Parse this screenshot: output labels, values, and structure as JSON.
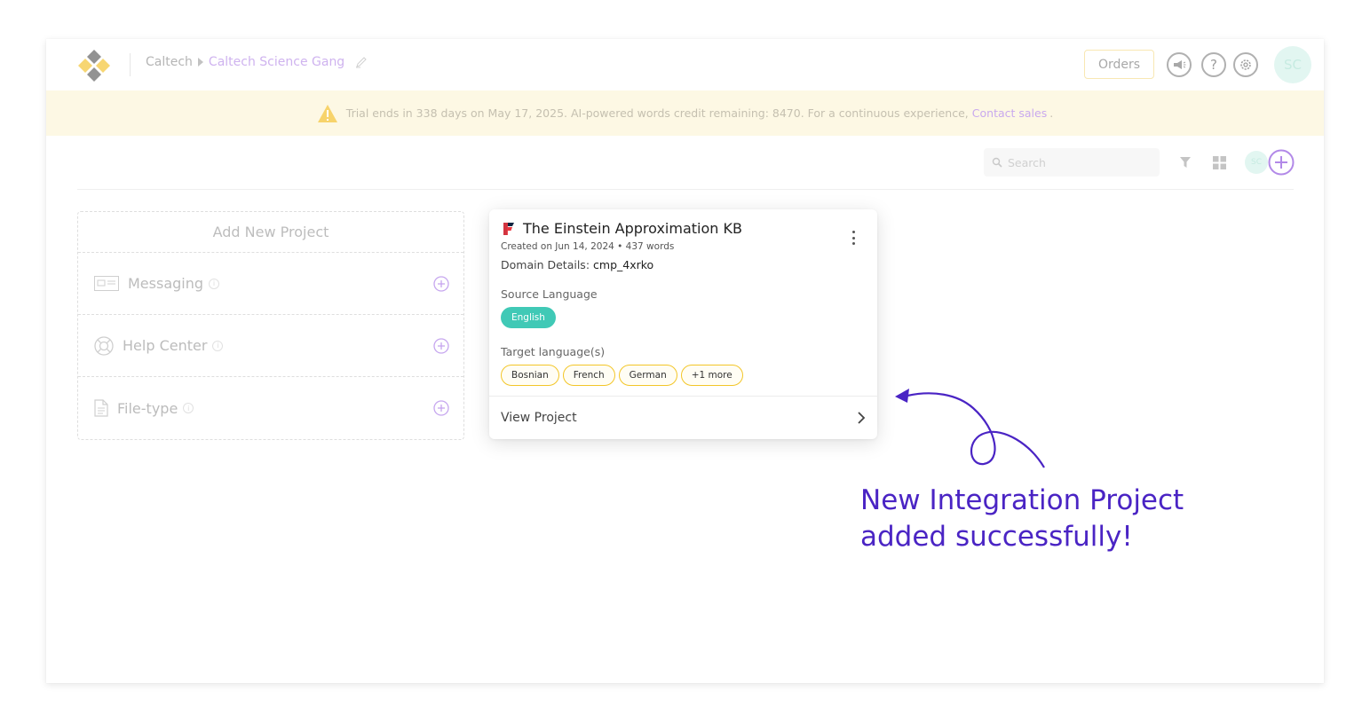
{
  "header": {
    "breadcrumb_org": "Caltech",
    "breadcrumb_workspace": "Caltech Science Gang",
    "orders_label": "Orders",
    "avatar_initials": "SC",
    "help_glyph": "?"
  },
  "banner": {
    "message": "Trial ends in 338 days on May 17, 2025. AI-powered words credit remaining: 8470. For a continuous experience,",
    "link": "Contact sales",
    "suffix": "."
  },
  "toolbar": {
    "search_placeholder": "Search",
    "avatar_initials": "SC"
  },
  "add_panel": {
    "title": "Add New Project",
    "rows": [
      {
        "label": "Messaging",
        "icon": "messaging-icon"
      },
      {
        "label": "Help Center",
        "icon": "help-center-icon"
      },
      {
        "label": "File-type",
        "icon": "file-icon"
      }
    ],
    "info_glyph": "i"
  },
  "project_card": {
    "title": "The Einstein Approximation KB",
    "meta": "Created on Jun 14, 2024 • 437 words",
    "domain_label": "Domain Details:",
    "domain_value": "cmp_4xrko",
    "source_label": "Source Language",
    "source_language": "English",
    "target_label": "Target language(s)",
    "target_languages": [
      "Bosnian",
      "French",
      "German",
      "+1 more"
    ],
    "view_label": "View Project"
  },
  "annotation": {
    "line1": "New Integration Project",
    "line2": "added successfully!"
  },
  "colors": {
    "accent_purple": "#4a24c4",
    "source_chip": "#40c9b6",
    "target_chip_border": "#f3c628",
    "banner_bg": "#fdf8e4"
  }
}
